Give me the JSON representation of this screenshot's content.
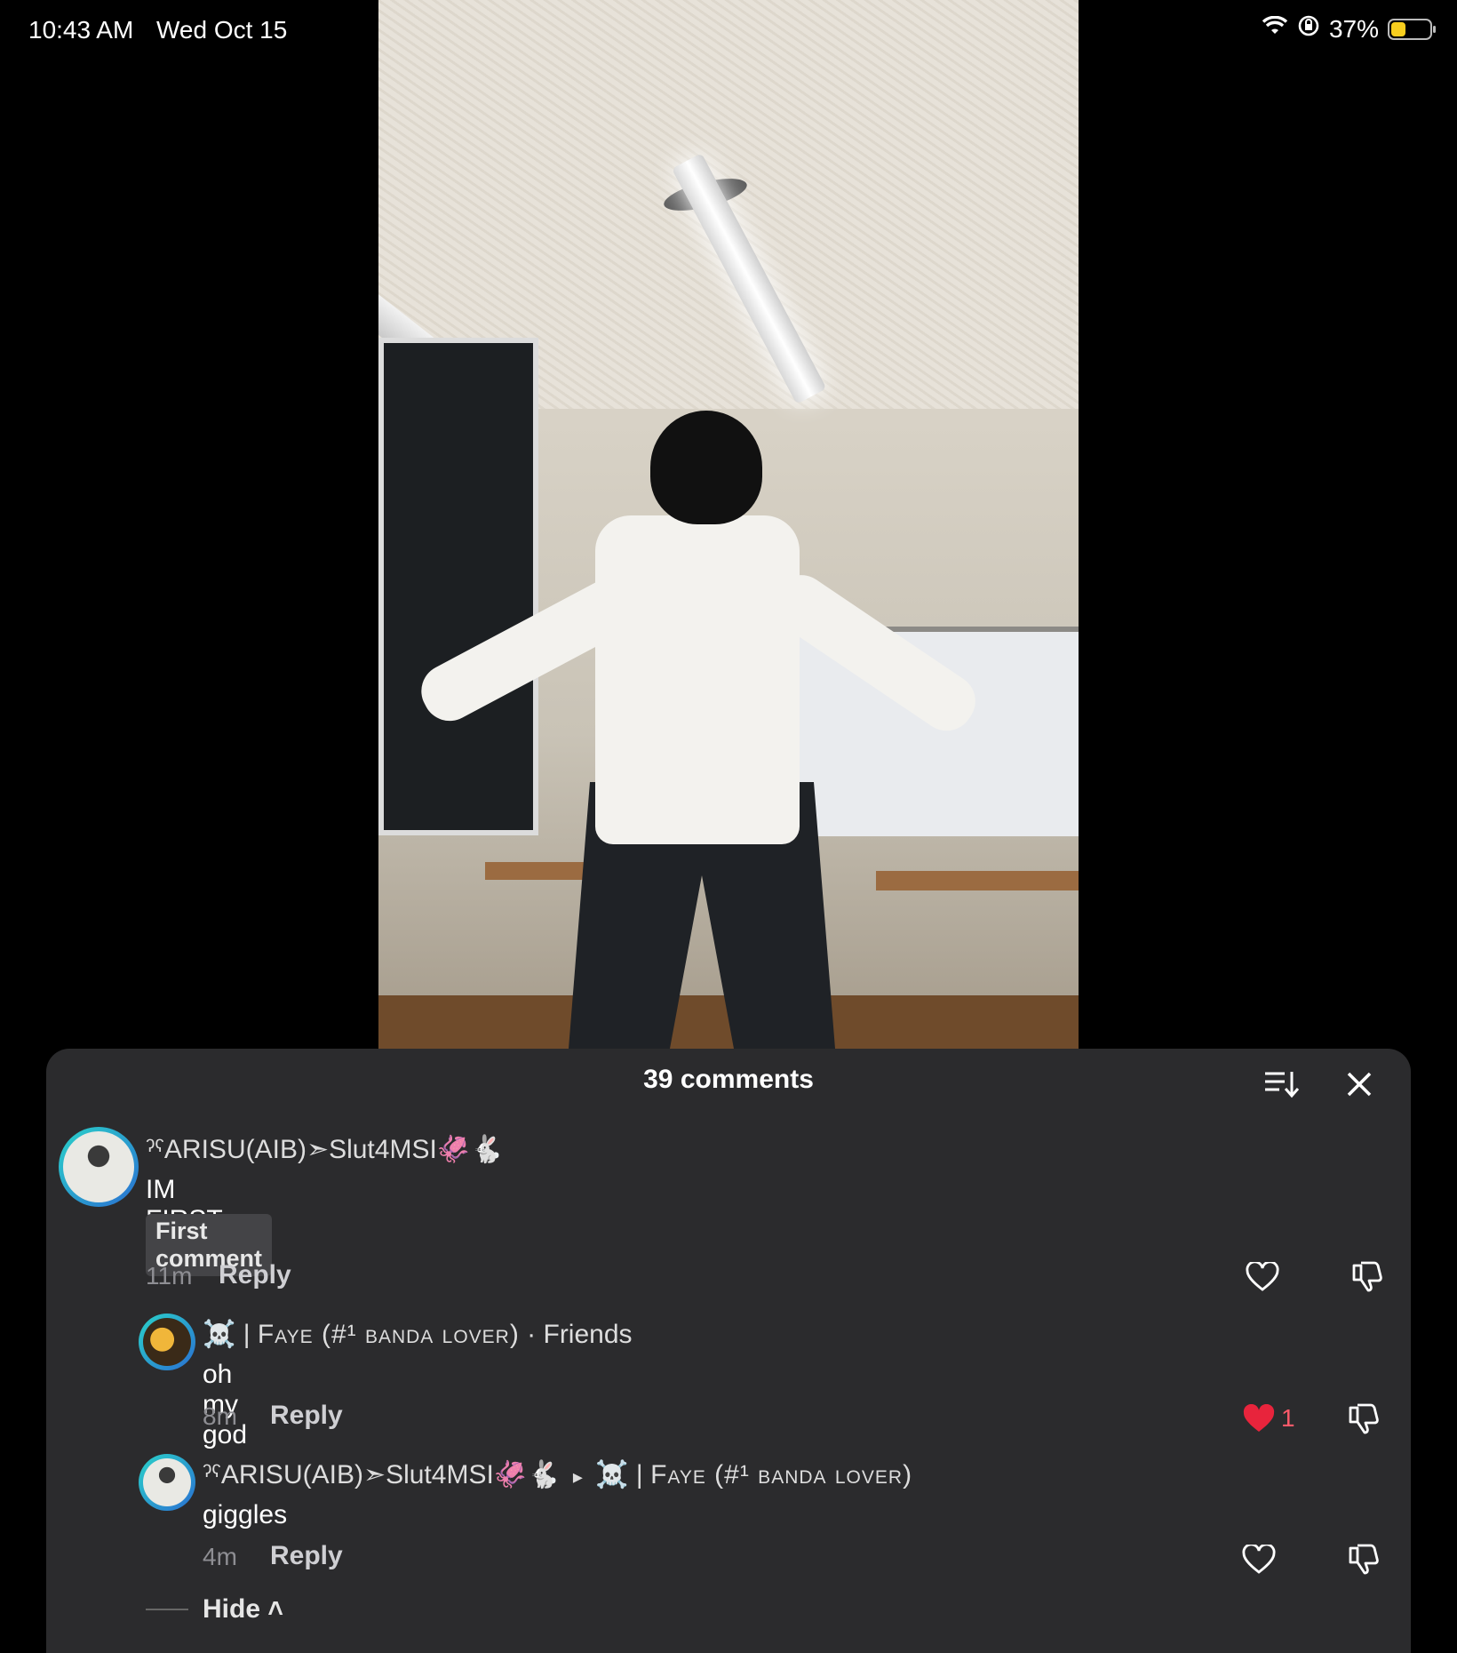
{
  "status_bar": {
    "time": "10:43 AM",
    "date": "Wed Oct 15",
    "battery": "37%",
    "battery_level": 0.37,
    "battery_color": "#f7ce1e"
  },
  "sheet": {
    "title": "39 comments",
    "sort_icon": "sort-icon",
    "close_icon": "close-icon"
  },
  "comments": [
    {
      "username": "ˀˁARISU(AIB)➣Slut4MSI🦑🐇",
      "text": "IM FIRST AGAIN",
      "badge": "First comment",
      "time": "11m",
      "reply": "Reply",
      "like_count": "",
      "liked": false
    },
    {
      "username_prefix": "☠️ | ",
      "username_main": "Faye (#¹ banda lover)",
      "username_suffix": " · Friends",
      "text": "oh my god",
      "time": "8m",
      "reply": "Reply",
      "like_count": "1",
      "liked": true
    },
    {
      "username": "ˀˁARISU(AIB)➣Slut4MSI🦑🐇",
      "reply_arrow": "▸",
      "reply_to_prefix": "☠️ | ",
      "reply_to_main": "Faye (#¹ banda lover)",
      "text": "giggles",
      "time": "4m",
      "reply": "Reply",
      "like_count": "",
      "liked": false
    }
  ],
  "hide_label": "Hide ˄",
  "colors": {
    "sheet_bg": "#2b2b2d",
    "liked_heart": "#e8243c",
    "avatar_ring": "#2ad2c9"
  }
}
